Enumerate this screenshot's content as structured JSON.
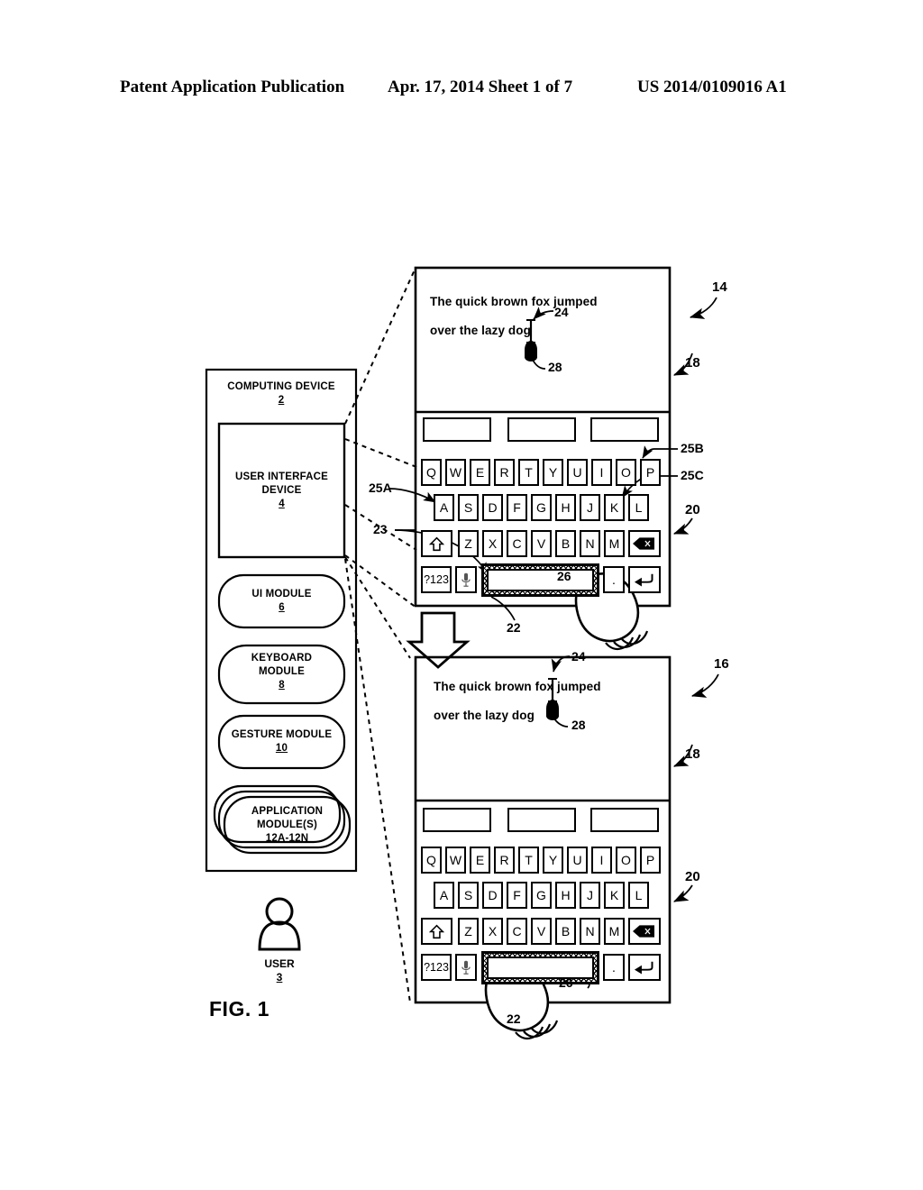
{
  "header": {
    "left": "Patent Application Publication",
    "middle": "Apr. 17, 2014  Sheet 1 of 7",
    "right": "US 2014/0109016 A1"
  },
  "figure": {
    "caption": "FIG. 1"
  },
  "block_diagram": {
    "computing_device": {
      "label": "COMPUTING DEVICE",
      "num": "2"
    },
    "ui_device": {
      "label": "USER INTERFACE\nDEVICE",
      "line1": "USER INTERFACE",
      "line2": "DEVICE",
      "num": "4"
    },
    "modules": [
      {
        "line1": "UI MODULE",
        "line2": "",
        "num": "6"
      },
      {
        "line1": "KEYBOARD",
        "line2": "MODULE",
        "num": "8"
      },
      {
        "line1": "GESTURE MODULE",
        "line2": "",
        "num": "10"
      },
      {
        "line1": "APPLICATION",
        "line2": "MODULE(S)",
        "num": "12A-12N"
      }
    ],
    "user": {
      "label": "USER",
      "num": "3"
    }
  },
  "devices": [
    {
      "id": "top",
      "ref": "14",
      "display_ref": "18",
      "keyboard_ref": "20",
      "text_line1": "The quick brown fox jumped",
      "text_line2": "over the lazy dog",
      "cursor_ref": "24",
      "marker_ref": "28",
      "spacebar_ref": "22",
      "gesture_ref": "26",
      "key_a_ref": "25A",
      "key_p_ref": "25B",
      "key_k_ref": "25C",
      "keyboard_region_ref": "23"
    },
    {
      "id": "bottom",
      "ref": "16",
      "display_ref": "18",
      "keyboard_ref": "20",
      "text_line1": "The quick brown fox jumped",
      "text_line2": "over the lazy dog",
      "cursor_ref": "24",
      "marker_ref": "28",
      "spacebar_ref": "22",
      "gesture_ref": "26"
    }
  ],
  "keyboard": {
    "suggestions": [
      "",
      "",
      ""
    ],
    "row1": [
      "Q",
      "W",
      "E",
      "R",
      "T",
      "Y",
      "U",
      "I",
      "O",
      "P"
    ],
    "row2": [
      "A",
      "S",
      "D",
      "F",
      "G",
      "H",
      "J",
      "K",
      "L"
    ],
    "row3_shift": "shift-icon",
    "row3": [
      "Z",
      "X",
      "C",
      "V",
      "B",
      "N",
      "M"
    ],
    "row3_backspace": "backspace-icon",
    "row4_numbers": "?123",
    "row4_mic": "microphone-icon",
    "row4_space": "spacebar",
    "row4_period": ".",
    "row4_enter": "enter-icon"
  }
}
